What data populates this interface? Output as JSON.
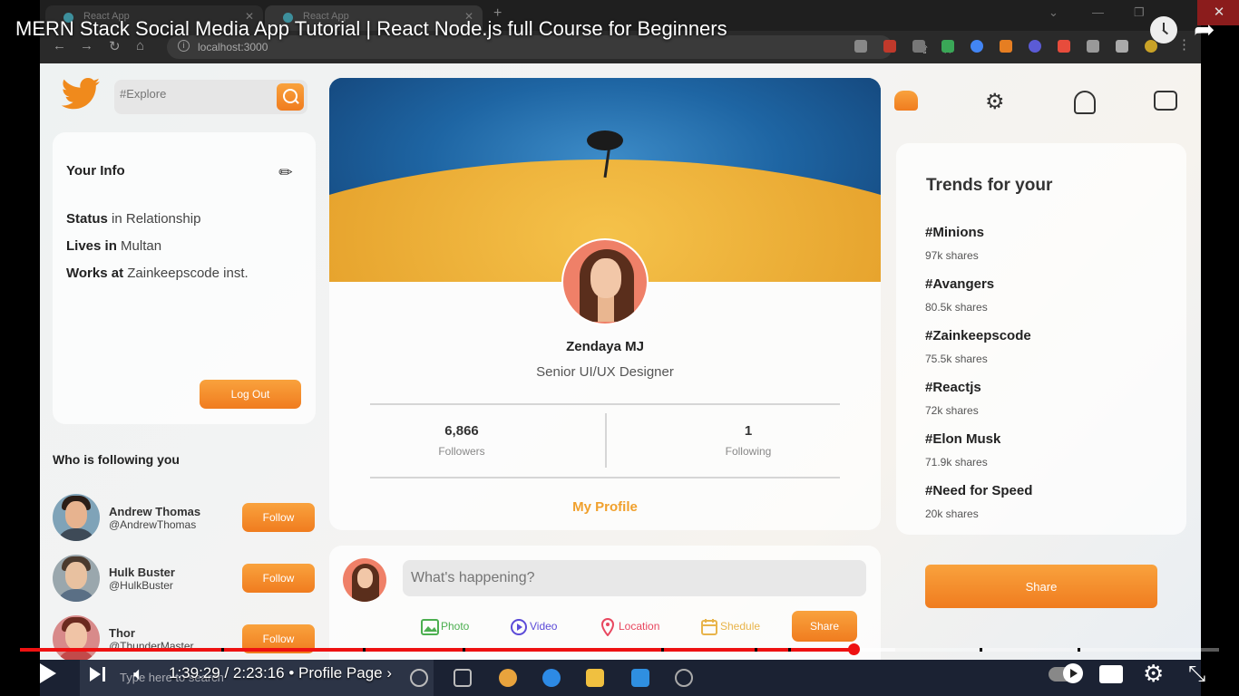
{
  "browser": {
    "tabs": [
      {
        "title": "React App"
      },
      {
        "title": "React App"
      }
    ],
    "address": "localhost:3000"
  },
  "video": {
    "title": "MERN Stack Social Media App Tutorial | React Node.js full Course for Beginners",
    "time_display": "1:39:29 / 2:23:16",
    "chapter": "• Profile Page ›",
    "progress_fraction": 0.695,
    "buffered_fraction": 0.73
  },
  "app": {
    "search": {
      "placeholder": "#Explore"
    },
    "info": {
      "title": "Your Info",
      "rows": [
        {
          "label": "Status",
          "value": "in Relationship"
        },
        {
          "label": "Lives in",
          "value": "Multan"
        },
        {
          "label": "Works at",
          "value": "Zainkeepscode inst."
        }
      ],
      "logout_label": "Log Out"
    },
    "followers": {
      "title": "Who is following you",
      "items": [
        {
          "name": "Andrew Thomas",
          "handle": "@AndrewThomas",
          "button": "Follow"
        },
        {
          "name": "Hulk Buster",
          "handle": "@HulkBuster",
          "button": "Follow"
        },
        {
          "name": "Thor",
          "handle": "@ThunderMaster",
          "button": "Follow"
        }
      ]
    },
    "profile": {
      "name": "Zendaya MJ",
      "role": "Senior UI/UX Designer",
      "followers_count": "6,866",
      "followers_label": "Followers",
      "following_count": "1",
      "following_label": "Following",
      "my_profile_label": "My Profile"
    },
    "post": {
      "placeholder": "What's happening?",
      "options": [
        {
          "label": "Photo",
          "color": "#4caf50"
        },
        {
          "label": "Video",
          "color": "#5c4bd8"
        },
        {
          "label": "Location",
          "color": "#e8475f"
        },
        {
          "label": "Shedule",
          "color": "#e8b44a"
        }
      ],
      "share_label": "Share"
    },
    "trends": {
      "title": "Trends for your",
      "items": [
        {
          "tag": "#Minions",
          "shares": "97k shares"
        },
        {
          "tag": "#Avangers",
          "shares": "80.5k shares"
        },
        {
          "tag": "#Zainkeepscode",
          "shares": "75.5k shares"
        },
        {
          "tag": "#Reactjs",
          "shares": "72k shares"
        },
        {
          "tag": "#Elon Musk",
          "shares": "71.9k shares"
        },
        {
          "tag": "#Need for Speed",
          "shares": "20k shares"
        }
      ]
    },
    "share_button": "Share"
  },
  "taskbar": {
    "search_placeholder": "Type here to search"
  },
  "colors": {
    "accent": "#f08a1c",
    "progress": "#ee1111"
  }
}
